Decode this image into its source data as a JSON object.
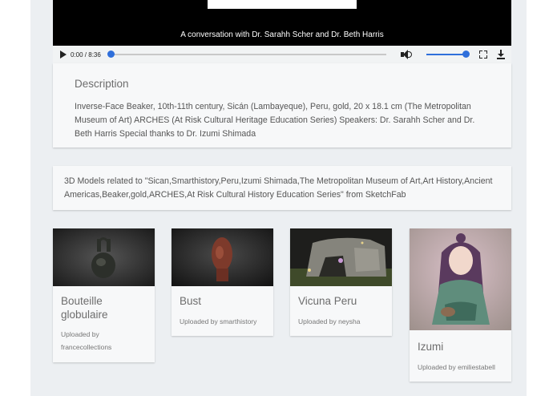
{
  "video": {
    "caption": "A conversation with Dr. Sarahh Scher and Dr. Beth Harris",
    "time": "0:00 / 8:36",
    "progress": 0.0,
    "volume": 1.0
  },
  "description": {
    "title": "Description",
    "text": "Inverse-Face Beaker, 10th-11th century, Sicán (Lambayeque), Peru, gold, 20 x 18.1 cm (The Metropolitan Museum of Art) ARCHES (At Risk Cultural Heritage Education Series) Speakers: Dr. Sarahh Scher and Dr. Beth Harris Special thanks to Dr. Izumi Shimada"
  },
  "related": {
    "text": "3D Models related to \"Sican,Smarthistory,Peru,Izumi Shimada,The Metropolitan Museum of Art,Art History,Ancient Americas,Beaker,gold,ARCHES,At Risk Cultural History Education Series\" from SketchFab"
  },
  "models": [
    {
      "title": "Bouteille globulaire",
      "uploaded": "Uploaded by francecollections"
    },
    {
      "title": "Bust",
      "uploaded": "Uploaded by smarthistory"
    },
    {
      "title": "Vicuna Peru",
      "uploaded": "Uploaded by neysha"
    },
    {
      "title": "Izumi",
      "uploaded": "Uploaded by emiliestabell"
    }
  ],
  "colors": {
    "accent": "#2f6fdb",
    "page_background": "#eceff2",
    "card_background": "#f7f8f9"
  }
}
